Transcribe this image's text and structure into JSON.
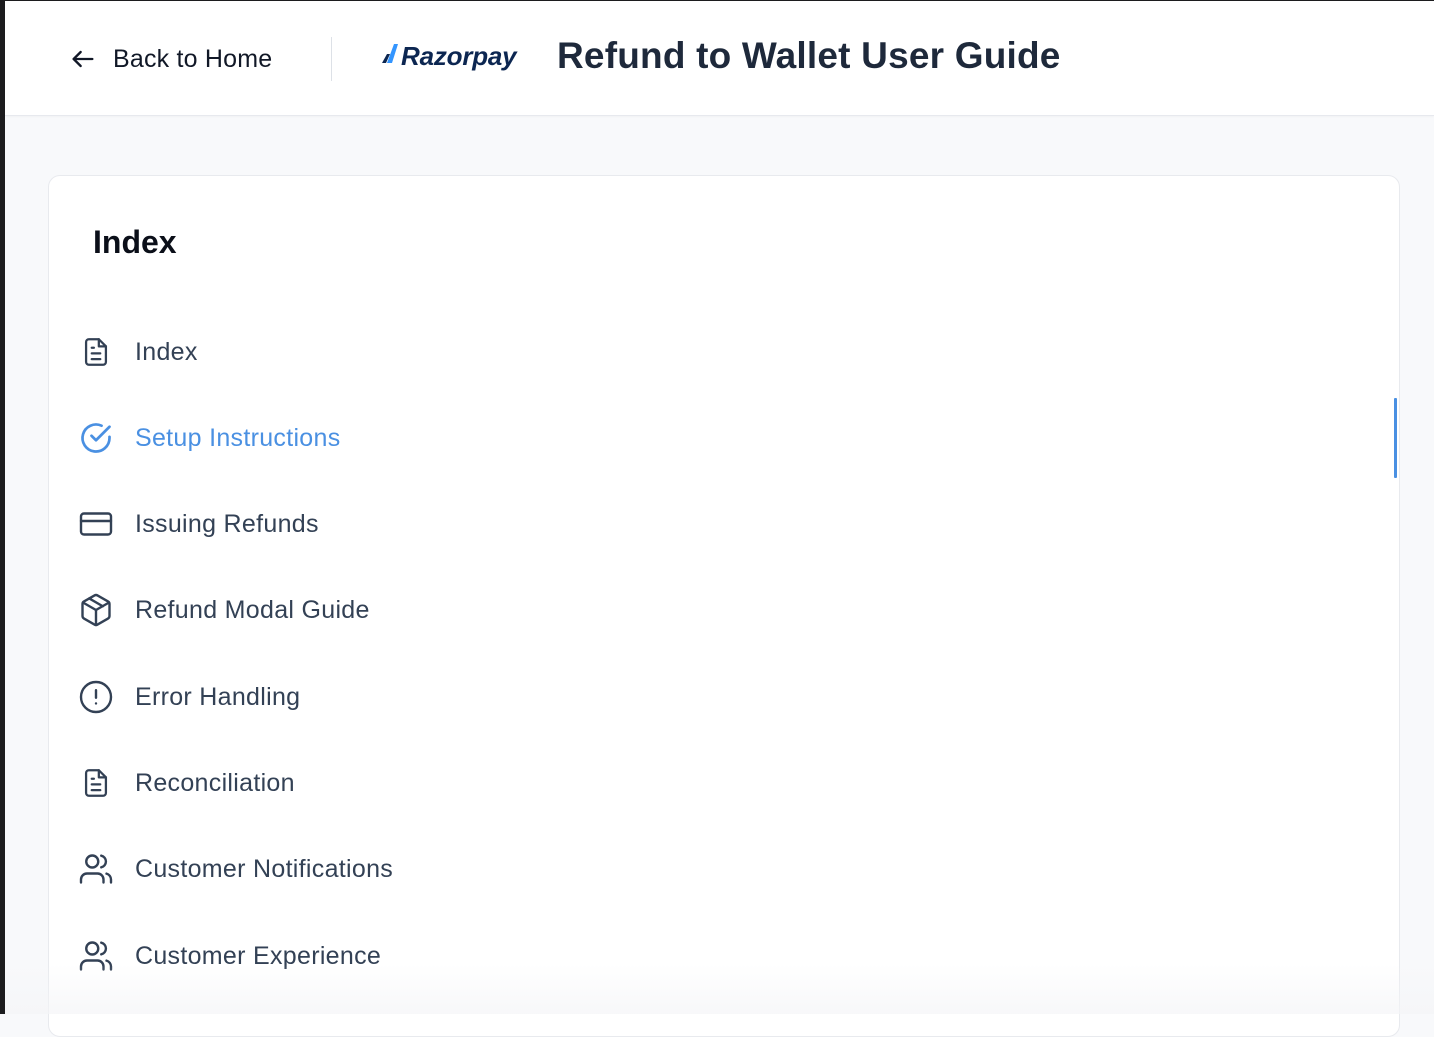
{
  "header": {
    "back_label": "Back to Home",
    "brand_name": "Razorpay",
    "title": "Refund to Wallet User Guide"
  },
  "index": {
    "heading": "Index",
    "items": [
      {
        "label": "Index",
        "icon": "document-icon"
      },
      {
        "label": "Setup Instructions",
        "icon": "check-circle-icon",
        "active": true
      },
      {
        "label": "Issuing Refunds",
        "icon": "credit-card-icon"
      },
      {
        "label": "Refund Modal Guide",
        "icon": "cube-icon"
      },
      {
        "label": "Error Handling",
        "icon": "alert-circle-icon"
      },
      {
        "label": "Reconciliation",
        "icon": "document-icon"
      },
      {
        "label": "Customer Notifications",
        "icon": "users-icon"
      },
      {
        "label": "Customer Experience",
        "icon": "users-icon"
      }
    ]
  },
  "colors": {
    "accent": "#4a90e2",
    "text": "#334155",
    "title": "#1e293b",
    "brand": "#0c2651",
    "brand_accent": "#3395ff",
    "background": "#f8f9fb"
  }
}
